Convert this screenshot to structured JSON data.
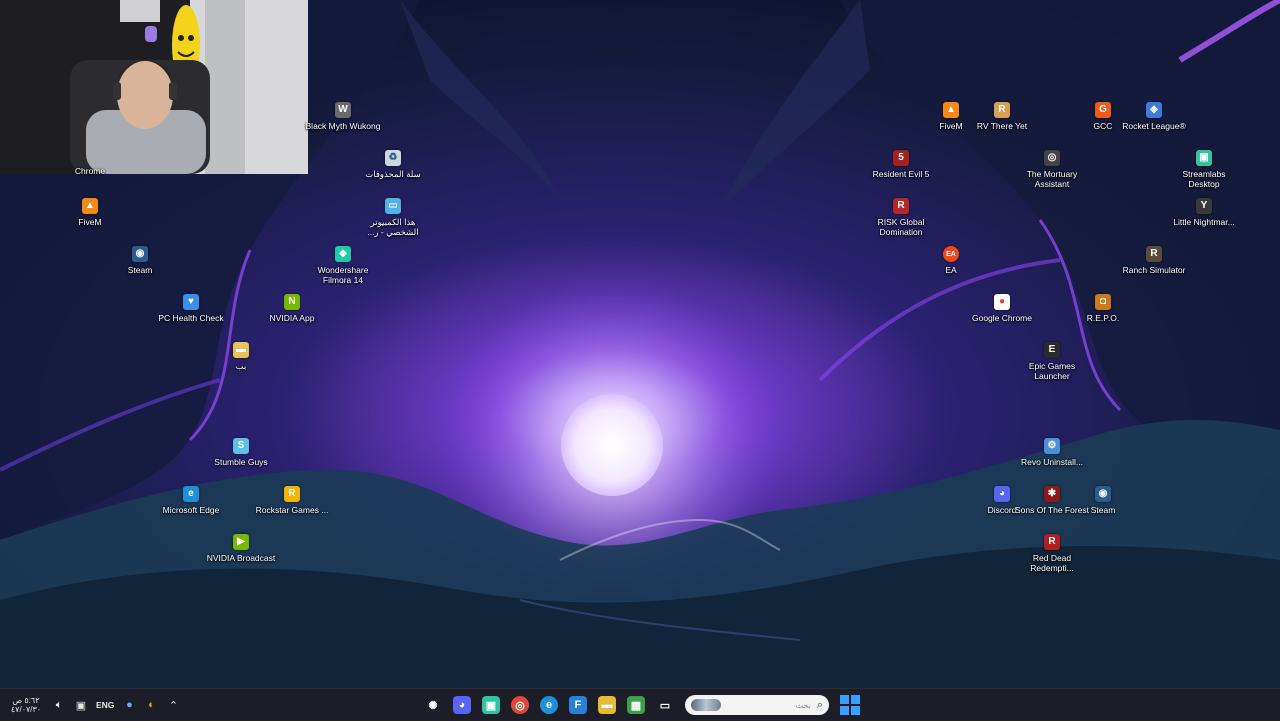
{
  "desktop": {
    "icons_left": [
      {
        "label": "Chrome",
        "icon": "chrome-icon",
        "color": "#ffffff",
        "glyph": "●"
      },
      {
        "label": "FiveM",
        "icon": "fivem-icon",
        "color": "#f28a1a",
        "glyph": "▲"
      },
      {
        "label": "Steam",
        "icon": "steam-icon",
        "color": "#2a5d8f",
        "glyph": "◉"
      },
      {
        "label": "PC Health Check",
        "icon": "pc-health-check-icon",
        "color": "#3c8ee6",
        "glyph": "♥"
      },
      {
        "label": "بب",
        "icon": "folder-icon",
        "color": "#e8c35a",
        "glyph": "▬"
      },
      {
        "label": "Stumble Guys",
        "icon": "stumble-guys-icon",
        "color": "#5cc0e8",
        "glyph": "S"
      },
      {
        "label": "Microsoft Edge",
        "icon": "edge-icon",
        "color": "#1e90d6",
        "glyph": "e"
      },
      {
        "label": "NVIDIA Broadcast",
        "icon": "nvidia-broadcast-icon",
        "color": "#76b900",
        "glyph": "▶"
      },
      {
        "label": "Black Myth Wukong",
        "icon": "black-myth-wukong-icon",
        "color": "#6a6a6a",
        "glyph": "W"
      },
      {
        "label": "سلة المحذوفات",
        "icon": "recycle-bin-icon",
        "color": "#cfd8e0",
        "glyph": "♻"
      },
      {
        "label": "هذا الكمبيوتر الشخصي - ر...",
        "icon": "this-pc-icon",
        "color": "#4fb3e6",
        "glyph": "▭"
      },
      {
        "label": "Wondershare Filmora 14",
        "icon": "filmora-icon",
        "color": "#1fc9a8",
        "glyph": "◆"
      },
      {
        "label": "NVIDIA App",
        "icon": "nvidia-app-icon",
        "color": "#76b900",
        "glyph": "N"
      },
      {
        "label": "Rockstar Games ...",
        "icon": "rockstar-icon",
        "color": "#f4b400",
        "glyph": "R"
      }
    ],
    "icons_right": [
      {
        "label": "FiveM",
        "icon": "fivem-icon",
        "color": "#f28a1a",
        "glyph": "▲"
      },
      {
        "label": "RV There Yet",
        "icon": "rv-there-yet-icon",
        "color": "#d9a05a",
        "glyph": "R"
      },
      {
        "label": "GCC",
        "icon": "gcc-icon",
        "color": "#f05a1a",
        "glyph": "G"
      },
      {
        "label": "Rocket League®",
        "icon": "rocket-league-icon",
        "color": "#3d7bd9",
        "glyph": "◈"
      },
      {
        "label": "Resident Evil 5",
        "icon": "resident-evil-5-icon",
        "color": "#a32020",
        "glyph": "5"
      },
      {
        "label": "The Mortuary Assistant",
        "icon": "mortuary-assistant-icon",
        "color": "#444444",
        "glyph": "◎"
      },
      {
        "label": "Streamlabs Desktop",
        "icon": "streamlabs-icon",
        "color": "#31c3a2",
        "glyph": "▣"
      },
      {
        "label": "RISK Global Domination",
        "icon": "risk-icon",
        "color": "#b3262a",
        "glyph": "R"
      },
      {
        "label": "Little Nightmar...",
        "icon": "little-nightmares-icon",
        "color": "#3a3a3a",
        "glyph": "Y"
      },
      {
        "label": "EA",
        "icon": "ea-icon",
        "color": "#f04a1a",
        "glyph": "EA"
      },
      {
        "label": "Ranch Simulator",
        "icon": "ranch-simulator-icon",
        "color": "#5a4a3a",
        "glyph": "R"
      },
      {
        "label": "Google Chrome",
        "icon": "chrome-icon",
        "color": "#ffffff",
        "glyph": "●"
      },
      {
        "label": "R.E.P.O.",
        "icon": "repo-icon",
        "color": "#c97a1a",
        "glyph": "◘"
      },
      {
        "label": "Epic Games Launcher",
        "icon": "epic-games-icon",
        "color": "#2a2a2a",
        "glyph": "E"
      },
      {
        "label": "Revo Uninstall...",
        "icon": "revo-uninstaller-icon",
        "color": "#4a90d9",
        "glyph": "⚙"
      },
      {
        "label": "Discord",
        "icon": "discord-icon",
        "color": "#5865f2",
        "glyph": "◕"
      },
      {
        "label": "Sons Of The Forest",
        "icon": "sons-of-the-forest-icon",
        "color": "#8a1a1a",
        "glyph": "✱"
      },
      {
        "label": "Steam",
        "icon": "steam-icon",
        "color": "#2a5d8f",
        "glyph": "◉"
      },
      {
        "label": "Red Dead Redempti...",
        "icon": "red-dead-redemption-icon",
        "color": "#b02020",
        "glyph": "R"
      }
    ]
  },
  "taskbar": {
    "clock_time": "٥:٦٢ ص",
    "clock_date": "٤٧/٠٧/٣٠",
    "language": "ENG",
    "search_placeholder": "بحث",
    "pinned": [
      {
        "icon": "steelseries-icon",
        "color": "#1c1d26",
        "glyph": "✺"
      },
      {
        "icon": "discord-icon",
        "color": "#5865f2",
        "glyph": "◕"
      },
      {
        "icon": "streamlabs-icon",
        "color": "#31c3a2",
        "glyph": "▣"
      },
      {
        "icon": "chrome-icon",
        "color": "#e0453a",
        "glyph": "◎"
      },
      {
        "icon": "edge-icon",
        "color": "#1e90d6",
        "glyph": "e"
      },
      {
        "icon": "filmora-icon",
        "color": "#2a7fd9",
        "glyph": "F"
      },
      {
        "icon": "file-explorer-icon",
        "color": "#e8b83a",
        "glyph": "▬"
      },
      {
        "icon": "gallery-icon",
        "color": "#3aa04a",
        "glyph": "▦"
      },
      {
        "icon": "task-view-icon",
        "color": "#1c1d26",
        "glyph": "▭"
      }
    ]
  }
}
